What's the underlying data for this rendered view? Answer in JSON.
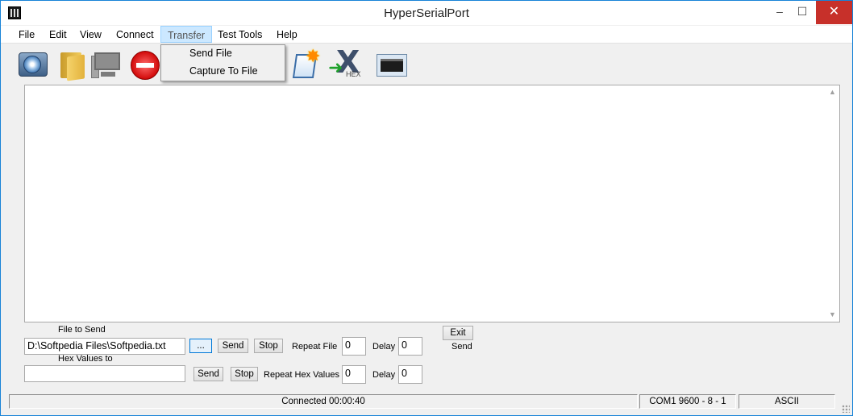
{
  "window": {
    "title": "HyperSerialPort"
  },
  "window_controls": {
    "minimize": "–",
    "maximize": "☐",
    "close": "✕"
  },
  "menu": {
    "items": [
      {
        "label": "File"
      },
      {
        "label": "Edit"
      },
      {
        "label": "View"
      },
      {
        "label": "Connect"
      },
      {
        "label": "Transfer"
      },
      {
        "label": "Test Tools"
      },
      {
        "label": "Help"
      }
    ],
    "open_menu": "Transfer",
    "transfer_dropdown": [
      {
        "label": "Send File"
      },
      {
        "label": "Capture To File"
      }
    ]
  },
  "toolbar": {
    "icons": [
      "disk-icon",
      "folder-icon",
      "computer-icon",
      "stop-icon",
      "new-document-icon",
      "hex-icon",
      "terminal-icon"
    ],
    "hex_label": "HEX"
  },
  "send_panel": {
    "file_label": "File to Send",
    "file_value": "D:\\Softpedia Files\\Softpedia.txt",
    "browse_label": "...",
    "send_label": "Send",
    "stop_label": "Stop",
    "repeat_file_label": "Repeat File",
    "repeat_file_value": "0",
    "delay_label": "Delay",
    "delay_file_value": "0",
    "hex_label": "Hex Values to",
    "hex_value": "",
    "hex_send_label": "Send",
    "hex_stop_label": "Stop",
    "repeat_hex_label": "Repeat Hex Values",
    "repeat_hex_value": "0",
    "delay_hex_value": "0",
    "exit_label": "Exit",
    "exit_send_label": "Send"
  },
  "status": {
    "connection": "Connected 00:00:40",
    "port": "COM1  9600 - 8 - 1",
    "mode": "ASCII"
  }
}
